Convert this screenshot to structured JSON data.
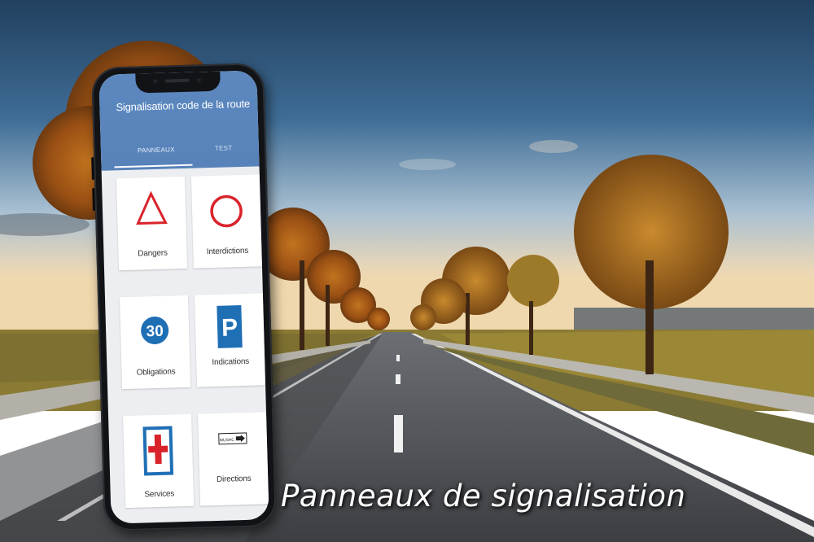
{
  "app": {
    "title": "Signalisation code de la route",
    "tabs": [
      {
        "label": "PANNEAUX",
        "selected": true
      },
      {
        "label": "TEST",
        "selected": false
      }
    ]
  },
  "categories": [
    {
      "label": "Dangers",
      "icon": "warning-triangle-icon"
    },
    {
      "label": "Interdictions",
      "icon": "prohibition-circle-icon"
    },
    {
      "label": "Obligations",
      "icon": "speed-limit-sign-icon",
      "sign_text": "30"
    },
    {
      "label": "Indications",
      "icon": "parking-sign-icon",
      "sign_text": "P"
    },
    {
      "label": "Services",
      "icon": "first-aid-cross-icon"
    },
    {
      "label": "Directions",
      "icon": "direction-arrow-sign-icon",
      "sign_text": "MUSAC"
    }
  ],
  "caption": "Panneaux de signalisation",
  "colors": {
    "appbar": "#5a86bd",
    "danger_red": "#d9232b",
    "sign_blue": "#1f6fb5",
    "screen_bg": "#eceef1"
  }
}
